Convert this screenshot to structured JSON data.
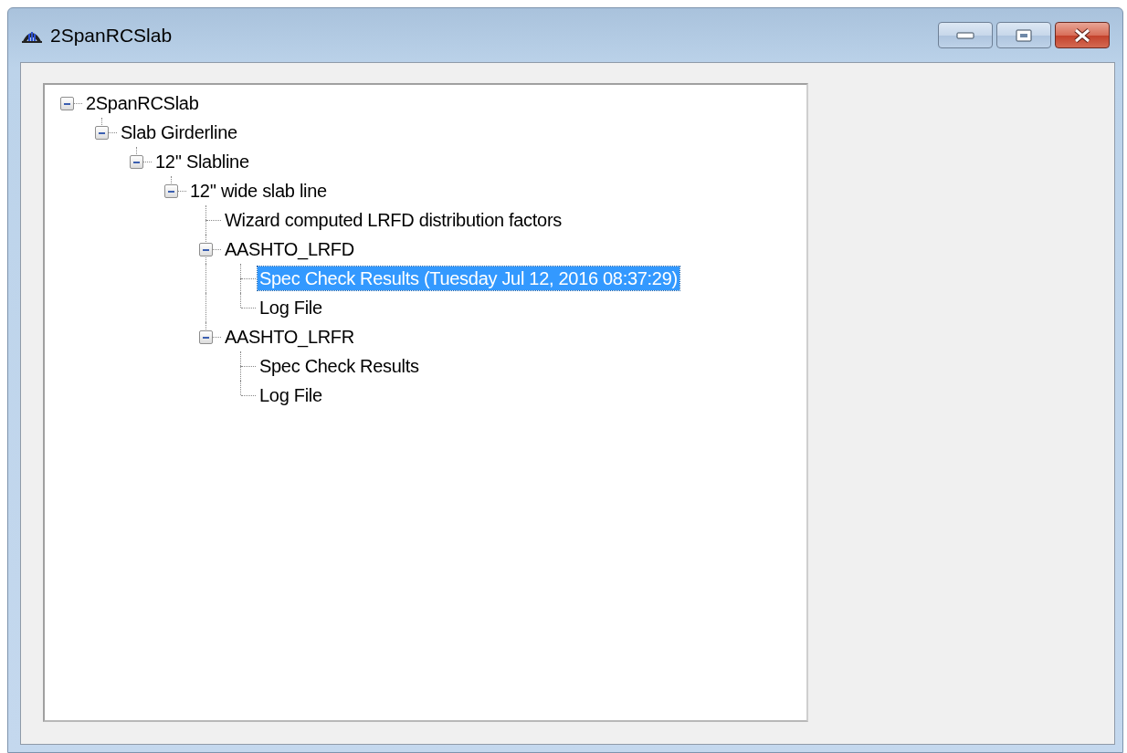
{
  "window": {
    "title": "2SpanRCSlab"
  },
  "tree": [
    {
      "label": "2SpanRCSlab",
      "expanded": true,
      "selected": false,
      "children": [
        {
          "label": "Slab Girderline",
          "expanded": true,
          "selected": false,
          "children": [
            {
              "label": "12'' Slabline",
              "expanded": true,
              "selected": false,
              "children": [
                {
                  "label": "12'' wide slab line",
                  "expanded": true,
                  "selected": false,
                  "children": [
                    {
                      "label": "Wizard computed LRFD distribution factors",
                      "selected": false
                    },
                    {
                      "label": "AASHTO_LRFD",
                      "expanded": true,
                      "selected": false,
                      "children": [
                        {
                          "label": "Spec Check Results (Tuesday Jul 12, 2016 08:37:29)",
                          "selected": true
                        },
                        {
                          "label": "Log File",
                          "selected": false
                        }
                      ]
                    },
                    {
                      "label": "AASHTO_LRFR",
                      "expanded": true,
                      "selected": false,
                      "children": [
                        {
                          "label": "Spec Check Results",
                          "selected": false
                        },
                        {
                          "label": "Log File",
                          "selected": false
                        }
                      ]
                    }
                  ]
                }
              ]
            }
          ]
        }
      ]
    }
  ]
}
